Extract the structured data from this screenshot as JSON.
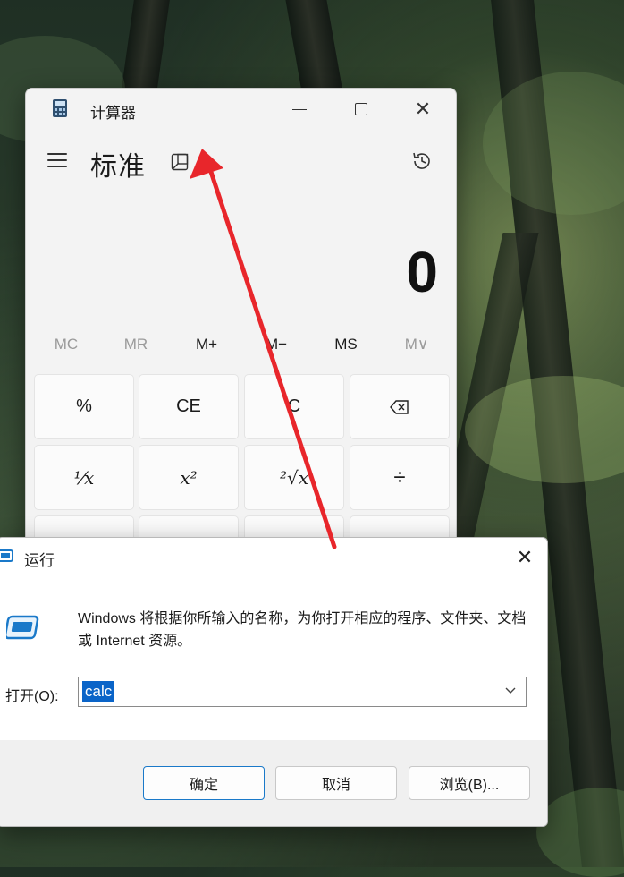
{
  "calculator": {
    "title": "计算器",
    "mode": "标准",
    "display_value": "0",
    "memory": [
      "MC",
      "MR",
      "M+",
      "M−",
      "MS",
      "M∨"
    ],
    "keys_row1": [
      "%",
      "CE",
      "C",
      "⌫"
    ],
    "keys_row2": [
      "¹⁄x",
      "x²",
      "²√x",
      "÷"
    ]
  },
  "run_dialog": {
    "title": "运行",
    "description": "Windows 将根据你所输入的名称，为你打开相应的程序、文件夹、文档或 Internet 资源。",
    "open_label": "打开(O):",
    "input_value": "calc",
    "buttons": {
      "ok": "确定",
      "cancel": "取消",
      "browse": "浏览(B)..."
    }
  },
  "colors": {
    "accent": "#0a64c8",
    "arrow": "#e8262b"
  }
}
